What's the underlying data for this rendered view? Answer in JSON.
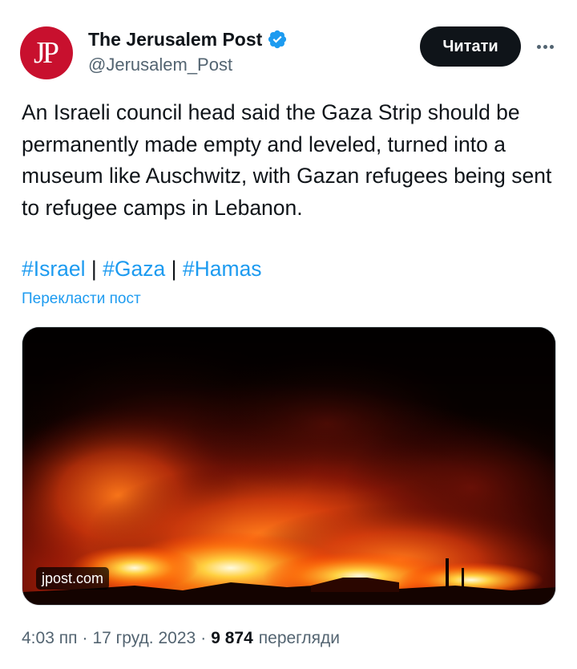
{
  "author": {
    "avatar_text": "JP",
    "display_name": "The Jerusalem Post",
    "verified_icon": "verified-badge-icon",
    "handle": "@Jerusalem_Post"
  },
  "actions": {
    "follow_label": "Читати",
    "more_icon": "more-horizontal-icon"
  },
  "tweet": {
    "text": "An Israeli council head said the Gaza Strip should be permanently made empty and leveled, turned into a museum like Auschwitz, with Gazan refugees being sent to refugee camps in Lebanon.",
    "hashtags": [
      "#Israel",
      "#Gaza",
      "#Hamas"
    ],
    "separator": "|",
    "translate_label": "Перекласти пост"
  },
  "media": {
    "source_label": "jpost.com"
  },
  "footer": {
    "time": "4:03 пп",
    "date": "17 груд. 2023",
    "dot": "·",
    "views_count": "9 874",
    "views_label": "перегляди"
  },
  "colors": {
    "accent": "#1d9bf0",
    "text": "#0f1419",
    "secondary": "#536471",
    "avatar_bg": "#c8102e"
  }
}
